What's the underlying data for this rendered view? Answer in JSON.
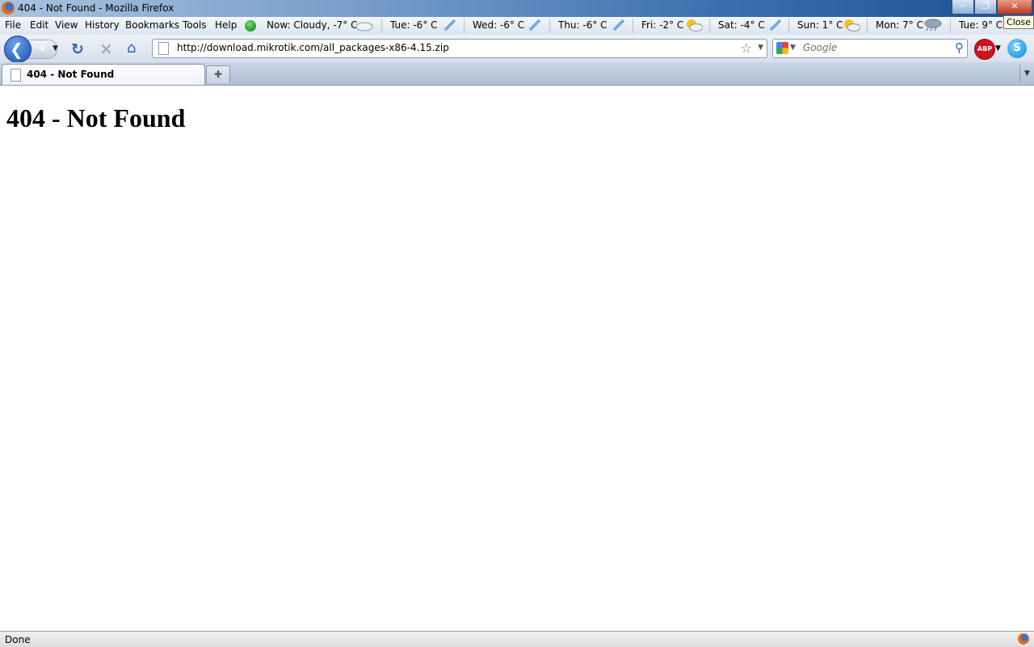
{
  "window": {
    "title": "404 - Not Found - Mozilla Firefox",
    "close_tooltip": "Close"
  },
  "menu": {
    "file": "File",
    "edit": "Edit",
    "view": "View",
    "history": "History",
    "bookmarks": "Bookmarks",
    "tools": "Tools",
    "help": "Help"
  },
  "weather": {
    "now": "Now: Cloudy, -7° C",
    "tue1": "Tue: -6° C",
    "wed": "Wed: -6° C",
    "thu": "Thu: -6° C",
    "fri": "Fri: -2° C",
    "sat": "Sat: -4° C",
    "sun": "Sun: 1° C",
    "mon": "Mon: 7° C",
    "tue2": "Tue: 9° C"
  },
  "nav": {
    "url": "http://download.mikrotik.com/all_packages-x86-4.15.zip",
    "search_placeholder": "Google",
    "abp_label": "ABP"
  },
  "tabs": [
    {
      "label": "404 - Not Found"
    }
  ],
  "page": {
    "heading": "404 - Not Found"
  },
  "status": {
    "text": "Done"
  }
}
